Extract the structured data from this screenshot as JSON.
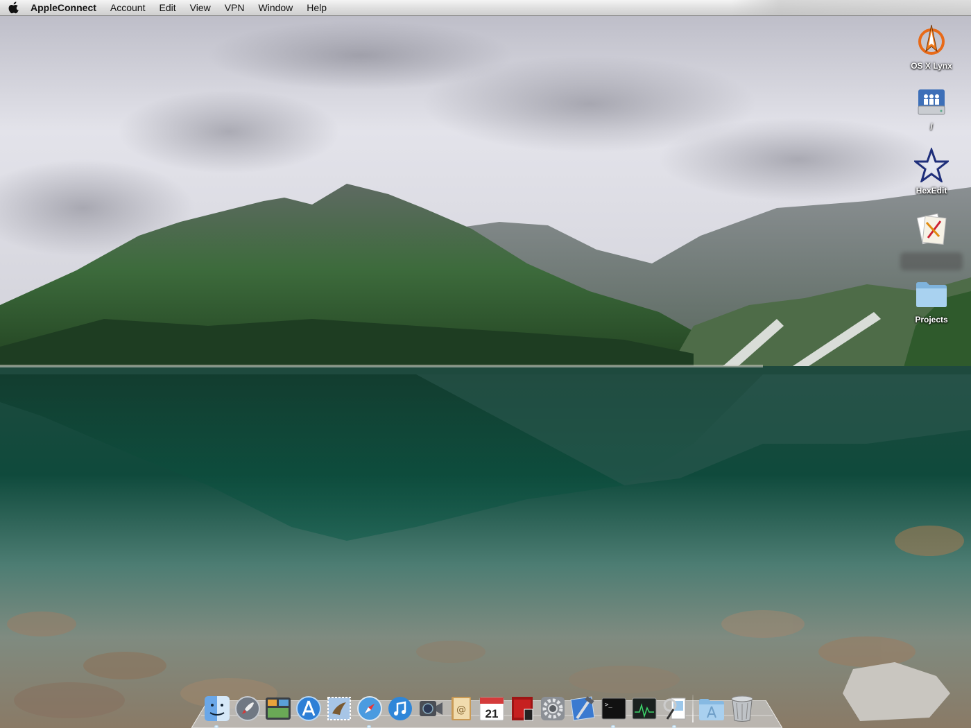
{
  "menubar": {
    "apple_icon": "apple-logo-icon",
    "app_name": "AppleConnect",
    "menus": [
      "Account",
      "Edit",
      "View",
      "VPN",
      "Window",
      "Help"
    ]
  },
  "desktop": {
    "icons": [
      {
        "label": "OS X Lynx",
        "icon": "lynx-compass-icon"
      },
      {
        "label": "/",
        "icon": "hard-drive-icon"
      },
      {
        "label": "HexEdit",
        "icon": "hexedit-star-icon"
      },
      {
        "label": "",
        "icon": "document-app-icon",
        "label_blurred": true
      },
      {
        "label": "Projects",
        "icon": "folder-icon"
      }
    ]
  },
  "dock": {
    "apps": [
      {
        "name": "Finder",
        "icon": "finder-icon",
        "running": true
      },
      {
        "name": "Launchpad",
        "icon": "launchpad-rocket-icon",
        "running": false
      },
      {
        "name": "Mission Control",
        "icon": "mission-control-icon",
        "running": false
      },
      {
        "name": "App Store",
        "icon": "app-store-icon",
        "running": false
      },
      {
        "name": "Mail",
        "icon": "mail-stamp-icon",
        "running": false
      },
      {
        "name": "Safari",
        "icon": "safari-compass-icon",
        "running": true
      },
      {
        "name": "iTunes",
        "icon": "itunes-note-icon",
        "running": false
      },
      {
        "name": "FaceTime",
        "icon": "facetime-camera-icon",
        "running": false
      },
      {
        "name": "Contacts",
        "icon": "address-book-icon",
        "running": false
      },
      {
        "name": "Calendar",
        "icon": "calendar-icon",
        "day": "21",
        "running": false
      },
      {
        "name": "Photo Booth",
        "icon": "photo-booth-icon",
        "running": false
      },
      {
        "name": "System Preferences",
        "icon": "system-preferences-gear-icon",
        "running": false
      },
      {
        "name": "Xcode",
        "icon": "xcode-hammer-icon",
        "running": false
      },
      {
        "name": "Terminal",
        "icon": "terminal-icon",
        "running": true
      },
      {
        "name": "Activity Monitor",
        "icon": "activity-monitor-icon",
        "running": false
      },
      {
        "name": "Preview",
        "icon": "preview-icon",
        "running": true
      }
    ],
    "stacks": [
      {
        "name": "Applications",
        "icon": "applications-folder-icon"
      },
      {
        "name": "Trash",
        "icon": "trash-icon"
      }
    ]
  }
}
